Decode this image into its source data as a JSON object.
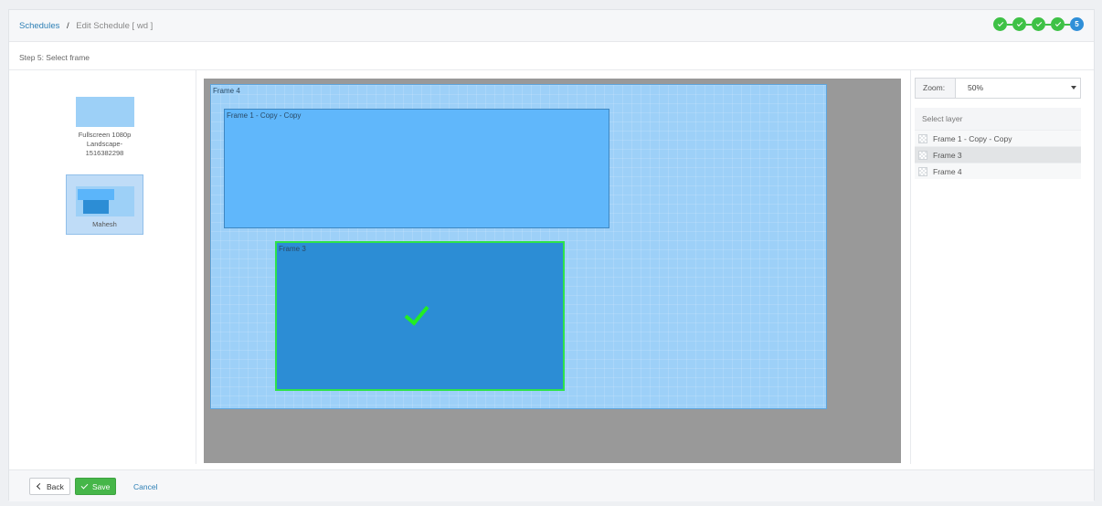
{
  "header": {
    "breadcrumb_root": "Schedules",
    "breadcrumb_sep": "/",
    "breadcrumb_current": "Edit Schedule  [ wd ]"
  },
  "wizard": {
    "steps": [
      {
        "state": "done"
      },
      {
        "state": "done"
      },
      {
        "state": "done"
      },
      {
        "state": "done"
      },
      {
        "state": "active",
        "label": "5"
      }
    ],
    "step_title": "Step 5: Select frame"
  },
  "layouts": [
    {
      "label": "Fullscreen 1080p Landscape-1516382298",
      "selected": false
    },
    {
      "label": "Mahesh",
      "selected": true
    }
  ],
  "canvas": {
    "frames": [
      {
        "name": "Frame 4"
      },
      {
        "name": "Frame 1 - Copy - Copy"
      },
      {
        "name": "Frame 3",
        "selected": true
      }
    ]
  },
  "zoom": {
    "label": "Zoom:",
    "value": "50%"
  },
  "layers": {
    "heading": "Select layer",
    "items": [
      {
        "name": "Frame 1 - Copy - Copy",
        "active": false
      },
      {
        "name": "Frame 3",
        "active": true
      },
      {
        "name": "Frame 4",
        "active": false
      }
    ]
  },
  "footer": {
    "back_label": "Back",
    "save_label": "Save",
    "cancel_label": "Cancel"
  },
  "colors": {
    "accent": "#2d7fb5",
    "success": "#46b649",
    "active_step": "#2f8fd8",
    "selected_frame_border": "#2ee34a"
  },
  "icons": {
    "back": "chevron-left-icon",
    "save": "check-icon",
    "layer": "transparency-grid-icon",
    "zoom_dropdown": "caret-down-icon",
    "selected_frame": "checkmark-icon"
  }
}
